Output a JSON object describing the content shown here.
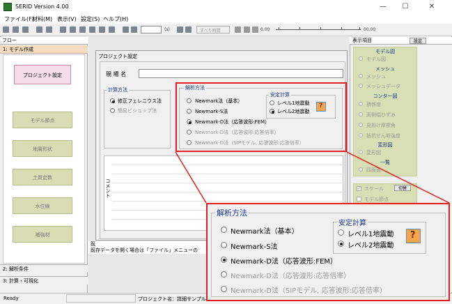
{
  "app": {
    "title": "SERID Version 4.00",
    "win_controls": [
      "—",
      "☐",
      "✕"
    ]
  },
  "menu": [
    "ファイル(F)",
    "材料(M)",
    "表示(V)",
    "設定(S)",
    "ヘルプ(H)"
  ],
  "toolbar": {
    "frame_unit": "(s)",
    "time_label": "すべり時間",
    "time_start": "0.00",
    "time_end": "00.00"
  },
  "flow": {
    "header": "フロー",
    "tab_active": "1: モデル作成",
    "buttons": [
      "プロジェクト設定",
      "モデル節点",
      "地層形状",
      "土質定数",
      "水位線",
      "補強材"
    ],
    "bottom_tabs": [
      "2: 解析条件",
      "3: 計算・可視化"
    ]
  },
  "dialog": {
    "title": "プロジェクト設定",
    "site_label": "現 場 名",
    "site_value": "",
    "calc_group": "計算方法",
    "calc_options": [
      {
        "label": "修正フェレニウス法",
        "selected": true,
        "enabled": true
      },
      {
        "label": "簡易ビショップ法",
        "selected": false,
        "enabled": false
      }
    ],
    "analysis_group": "解析方法",
    "analysis_options": [
      {
        "label": "Newmark法（基本）",
        "selected": false,
        "enabled": true
      },
      {
        "label": "Newmark-S法",
        "selected": false,
        "enabled": true
      },
      {
        "label": "Newmark-D法（応答波形:FEM）",
        "selected": true,
        "enabled": true
      },
      {
        "label": "Newmark-D法（応答波形:応答倍率）",
        "selected": false,
        "enabled": false
      },
      {
        "label": "Newmark-D法（SIPモデル, 応答波形:応答倍率）",
        "selected": false,
        "enabled": false
      }
    ],
    "stability_group": "安定計算",
    "stability_options": [
      {
        "label": "レベル1地震動",
        "selected": false
      },
      {
        "label": "レベル2地震動",
        "selected": true
      }
    ],
    "help_button": "?",
    "comment_label": "コメント"
  },
  "callout": {
    "analysis_group": "解析方法",
    "analysis_options": [
      {
        "label": "Newmark法（基本）",
        "selected": false,
        "enabled": true
      },
      {
        "label": "Newmark-S法",
        "selected": false,
        "enabled": true
      },
      {
        "label": "Newmark-D法（応答波形:FEM）",
        "selected": true,
        "enabled": true
      },
      {
        "label": "Newmark-D法（応答波形:応答倍率）",
        "selected": false,
        "enabled": false
      },
      {
        "label": "Newmark-D法（SIPモデル, 応答波形:応答倍率）",
        "selected": false,
        "enabled": false
      }
    ],
    "stability_group": "安定計算",
    "stability_options": [
      {
        "label": "レベル1地震動",
        "selected": false
      },
      {
        "label": "レベル2地震動",
        "selected": true
      }
    ],
    "help_button": "?"
  },
  "status_strip": {
    "line1": "既",
    "line2": "既存データを開く場合は「ファイル」メニューの"
  },
  "statusbar": {
    "ready": "Ready",
    "project": "プロジェクト名：詳細サンプル"
  },
  "right_panel": {
    "header": "表示項目",
    "setting_button": "設定",
    "sections": [
      {
        "head": "モデル図",
        "items": [
          "モデル図"
        ]
      },
      {
        "head": "メッシュ",
        "items": [
          "メッシュ",
          "メッシュデータ"
        ]
      },
      {
        "head": "コンター図",
        "items": [
          "積係度",
          "両側幅ひずみ",
          "見掛け摩擦角",
          "抵抗せん断強度"
        ]
      },
      {
        "head": "変形図",
        "items": [
          "変形図"
        ]
      },
      {
        "head": "一覧",
        "items": [
          "四面面"
        ]
      }
    ],
    "checks": [
      {
        "label": "スケール",
        "checked": true
      },
      {
        "label": "モデル節点",
        "checked": false
      }
    ],
    "switch_button": "切替"
  },
  "colors": {
    "highlight": "#e02020",
    "group_title": "#1a3a8a",
    "flow_button": "#d8ddb4",
    "flow_button_active": "#f5dde8"
  }
}
